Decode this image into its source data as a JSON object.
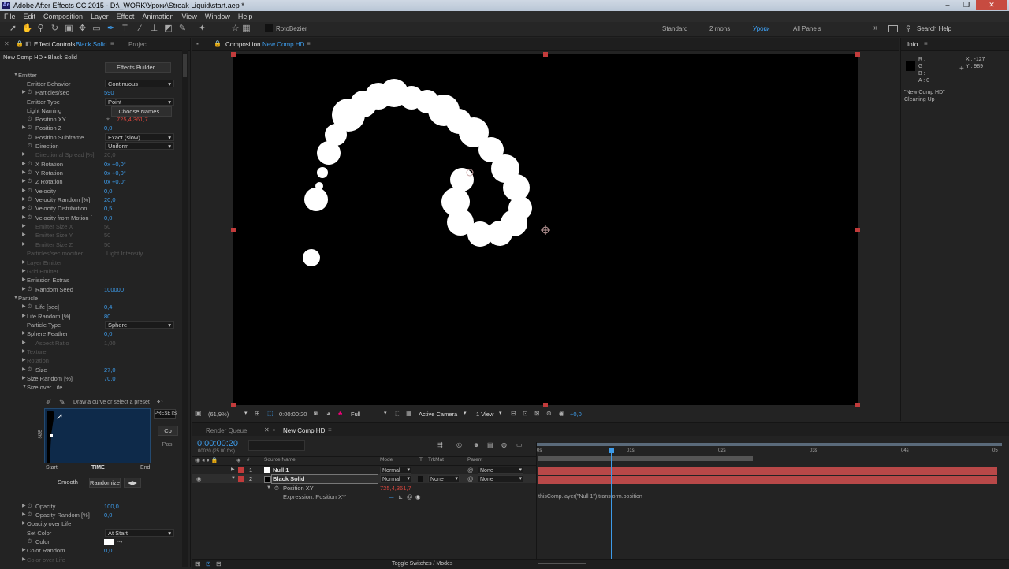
{
  "app": {
    "title": "Adobe After Effects CC 2015 - D:\\_WORK\\Уроки\\Streak Liquid\\start.aep *",
    "logo": "Ae"
  },
  "menu": [
    "File",
    "Edit",
    "Composition",
    "Layer",
    "Effect",
    "Animation",
    "View",
    "Window",
    "Help"
  ],
  "toolbar": {
    "rotobezier": "RotoBezier",
    "workspaces": [
      "Standard",
      "2 mons",
      "Уроки",
      "All Panels"
    ],
    "search_help": "Search Help"
  },
  "effect_controls": {
    "tab_label": "Effect Controls",
    "tab_layer": "Black Solid",
    "project_tab": "Project",
    "breadcrumb": "New Comp HD • Black Solid",
    "effects_builder": "Effects Builder...",
    "emitter": "Emitter",
    "emitter_behavior": {
      "label": "Emitter Behavior",
      "value": "Continuous"
    },
    "particles_sec": {
      "label": "Particles/sec",
      "value": "590"
    },
    "emitter_type": {
      "label": "Emitter Type",
      "value": "Point"
    },
    "light_naming": {
      "label": "Light Naming",
      "value": "Choose Names..."
    },
    "position_xy": {
      "label": "Position XY",
      "value": "725,4,361,7"
    },
    "position_z": {
      "label": "Position Z",
      "value": "0,0"
    },
    "position_subframe": {
      "label": "Position Subframe",
      "value": "Exact (slow)"
    },
    "direction": {
      "label": "Direction",
      "value": "Uniform"
    },
    "directional_spread": {
      "label": "Directional Spread [%]",
      "value": "20,0"
    },
    "x_rotation": {
      "label": "X Rotation",
      "value": "0x +0,0°"
    },
    "y_rotation": {
      "label": "Y Rotation",
      "value": "0x +0,0°"
    },
    "z_rotation": {
      "label": "Z Rotation",
      "value": "0x +0,0°"
    },
    "velocity": {
      "label": "Velocity",
      "value": "0,0"
    },
    "velocity_random": {
      "label": "Velocity Random [%]",
      "value": "20,0"
    },
    "velocity_distribution": {
      "label": "Velocity Distribution",
      "value": "0,5"
    },
    "velocity_from_motion": {
      "label": "Velocity from Motion [",
      "value": "0,0"
    },
    "emitter_size_x": {
      "label": "Emitter Size X",
      "value": "50"
    },
    "emitter_size_y": {
      "label": "Emitter Size Y",
      "value": "50"
    },
    "emitter_size_z": {
      "label": "Emitter Size Z",
      "value": "50"
    },
    "particles_per_emitter": {
      "label": "Particles/sec modifier",
      "value": "Light Intensity"
    },
    "layer_emitter": "Layer Emitter",
    "grid_emitter": "Grid Emitter",
    "emission_extras": "Emission Extras",
    "random_seed": {
      "label": "Random Seed",
      "value": "100000"
    },
    "particle": "Particle",
    "life": {
      "label": "Life [sec]",
      "value": "0,4"
    },
    "life_random": {
      "label": "Life Random [%]",
      "value": "80"
    },
    "particle_type": {
      "label": "Particle Type",
      "value": "Sphere"
    },
    "sphere_feather": {
      "label": "Sphere Feather",
      "value": "0,0"
    },
    "aspect_ratio": {
      "label": "Aspect Ratio",
      "value": "1,00"
    },
    "texture": "Texture",
    "rotation": "Rotation",
    "size": {
      "label": "Size",
      "value": "27,0"
    },
    "size_random": {
      "label": "Size Random [%]",
      "value": "70,0"
    },
    "size_over_life": "Size over Life",
    "curve_hint": "Draw a curve or select a preset",
    "presets": "PRESETS",
    "copy_btn": "Co",
    "paste_btn": "Pas",
    "curve_axis_size": "SIZE",
    "curve_start": "Start",
    "curve_time": "TIME",
    "curve_end": "End",
    "smooth": "Smooth",
    "randomize": "Randomize",
    "opacity": {
      "label": "Opacity",
      "value": "100,0"
    },
    "opacity_random": {
      "label": "Opacity Random [%]",
      "value": "0,0"
    },
    "opacity_over_life": "Opacity over Life",
    "set_color": {
      "label": "Set Color",
      "value": "At Start"
    },
    "color": {
      "label": "Color"
    },
    "color_random": {
      "label": "Color Random",
      "value": "0,0"
    },
    "color_over_life": "Color over Life"
  },
  "composition": {
    "tab_label": "Composition",
    "comp_name": "New Comp HD",
    "zoom": "(61,9%)",
    "timecode": "0:00:00:20",
    "resolution": "Full",
    "camera": "Active Camera",
    "views": "1 View",
    "exposure": "+0,0"
  },
  "info": {
    "title": "Info",
    "r": "R :",
    "g": "G :",
    "b": "B :",
    "a": "A : 0",
    "x": "X : -127",
    "y": "Y : 989",
    "status_line1": "\"New Comp HD\"",
    "status_line2": "Cleaning Up"
  },
  "timeline": {
    "render_queue": "Render Queue",
    "comp_tab": "New Comp HD",
    "timecode": "0:00:00:20",
    "frame_info": "00020 (25.00 fps)",
    "col_source": "Source Name",
    "col_mode": "Mode",
    "col_t": "T",
    "col_trkmat": "TrkMat",
    "col_parent": "Parent",
    "layers": [
      {
        "num": "1",
        "name": "Null 1",
        "mode": "Normal",
        "trkmat": "",
        "parent": "None"
      },
      {
        "num": "2",
        "name": "Black Solid",
        "mode": "Normal",
        "trkmat": "None",
        "parent": "None"
      }
    ],
    "prop_position": "Position XY",
    "prop_position_value": "725,4,361,7",
    "prop_expression": "Expression: Position XY",
    "expression_text": "thisComp.layer(\"Null 1\").transform.position",
    "ruler": [
      "0s",
      "01s",
      "02s",
      "03s",
      "04s",
      "05"
    ],
    "toggle_label": "Toggle Switches / Modes"
  },
  "colors": {
    "accent": "#3d9be9",
    "layer_bar": "#b84848",
    "handle": "#c23b3b",
    "panel": "#232323"
  }
}
